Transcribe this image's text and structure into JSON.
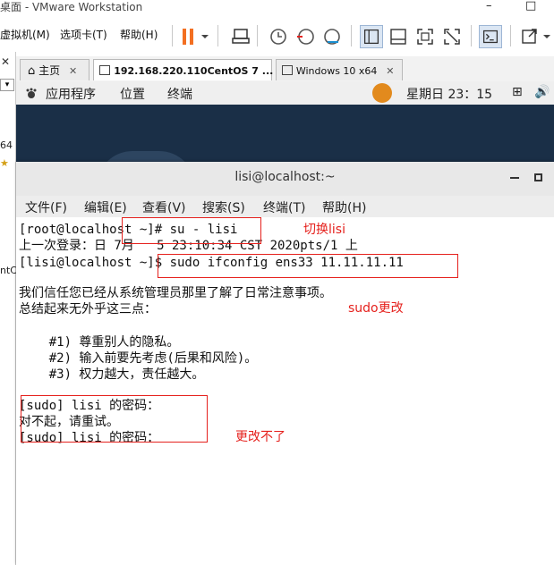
{
  "window": {
    "title": "桌面 - VMware Workstation",
    "minimize": "–",
    "maximize": "□"
  },
  "menubar": {
    "items": [
      "虚拟机(M)",
      "选项卡(T)",
      "帮助(H)"
    ]
  },
  "sidebar": {
    "fragment_1": "64",
    "fragment_2": "ntC"
  },
  "tabs": [
    {
      "label": "主页"
    },
    {
      "label": "192.168.220.110CentOS 7 ..."
    },
    {
      "label": "Windows 10 x64"
    }
  ],
  "gnome": {
    "apps": "应用程序",
    "places": "位置",
    "terminal": "终端",
    "clock": "星期日 23：15"
  },
  "terminal": {
    "title": "lisi@localhost:~",
    "menu": [
      "文件(F)",
      "编辑(E)",
      "查看(V)",
      "搜索(S)",
      "终端(T)",
      "帮助(H)"
    ],
    "lines": [
      "[root@localhost ~]# su - lisi",
      "上一次登录：日 7月   5 23:10:34 CST 2020pts/1 上",
      "[lisi@localhost ~]$ sudo ifconfig ens33 11.11.11.11",
      "",
      "我们信任您已经从系统管理员那里了解了日常注意事项。",
      "总结起来无外乎这三点：",
      "",
      "    #1) 尊重别人的隐私。",
      "    #2) 输入前要先考虑(后果和风险)。",
      "    #3) 权力越大，责任越大。",
      "",
      "[sudo] lisi 的密码：",
      "对不起，请重试。",
      "[sudo] lisi 的密码："
    ]
  },
  "annotations": {
    "switch_user": "切换lisi",
    "sudo_change": "sudo更改",
    "cannot_change": "更改不了"
  },
  "colors": {
    "annotation_red": "#e5211d",
    "pause_orange": "#f36f21",
    "desktop_bg": "#1a2f47"
  }
}
